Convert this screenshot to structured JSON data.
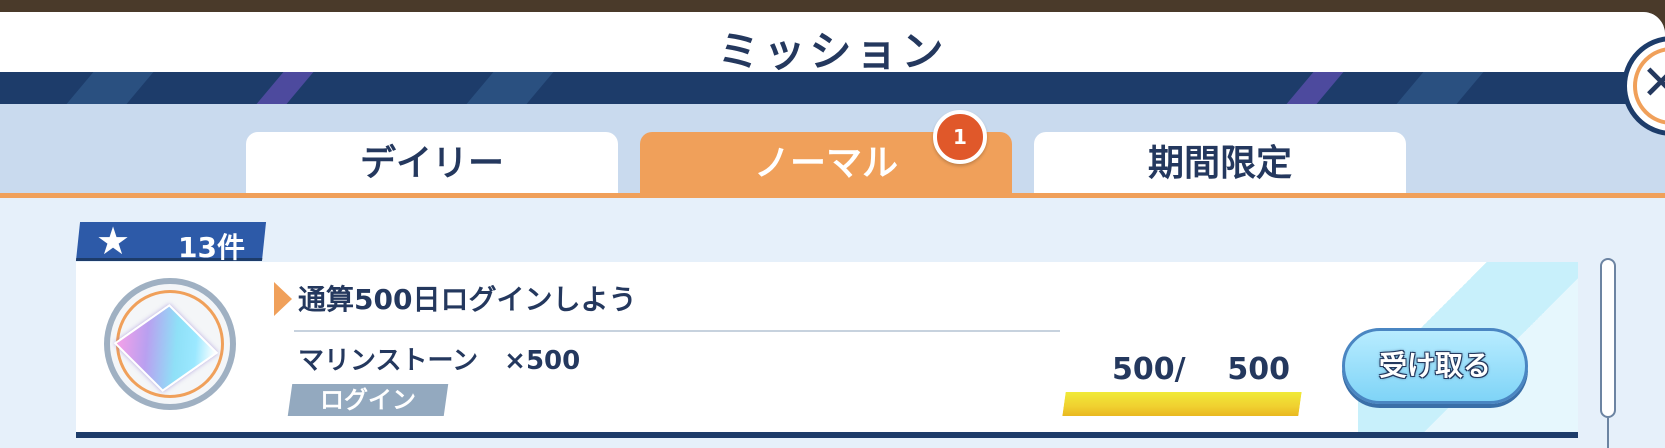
{
  "dialog": {
    "title": "ミッション",
    "close_icon": "close-icon"
  },
  "tabs": [
    {
      "label": "デイリー",
      "active": false
    },
    {
      "label": "ノーマル",
      "active": true,
      "badge": "1"
    },
    {
      "label": "期間限定",
      "active": false
    }
  ],
  "list": {
    "count_label": "13件",
    "count_icon": "star-icon"
  },
  "missions": [
    {
      "title": "通算500日ログインしよう",
      "reward": "マリンストーン　×500",
      "category": "ログイン",
      "progress_text": "500/    500",
      "progress_fraction": 1.0,
      "button_label": "受け取る",
      "reward_icon": "marine-stone-gem-icon"
    }
  ],
  "colors": {
    "navy": "#1d3c6a",
    "accent_orange": "#f0a05a",
    "button_blue": "#7fd4f7",
    "progress_yellow": "#f0d030"
  }
}
